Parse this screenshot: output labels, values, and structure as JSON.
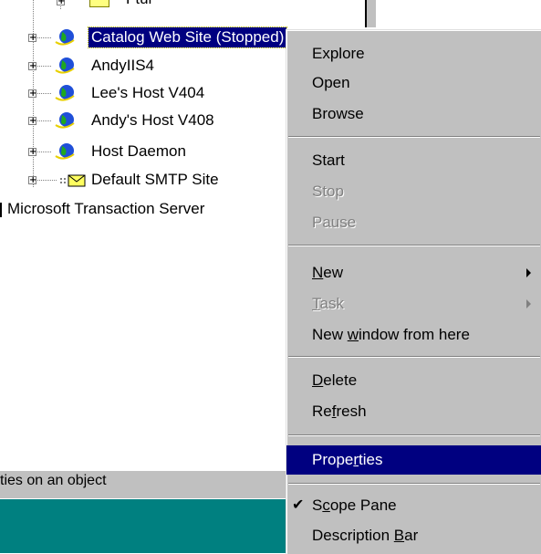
{
  "tree": {
    "partial_top_label": "Ftur",
    "nodes": [
      {
        "label": "Catalog Web Site (Stopped)",
        "icon": "globe-icon",
        "selected": true
      },
      {
        "label": "AndyIIS4",
        "icon": "globe-icon"
      },
      {
        "label": "Lee's Host V404",
        "icon": "globe-icon"
      },
      {
        "label": "Andy's Host V408",
        "icon": "globe-icon"
      },
      {
        "label": "Host Daemon",
        "icon": "globe-icon"
      },
      {
        "label": "Default SMTP Site",
        "icon": "smtp-icon"
      }
    ],
    "root_item": "Microsoft Transaction Server"
  },
  "status_bar": {
    "text": "ties on an object"
  },
  "context_menu": {
    "explore": "Explore",
    "open": "Open",
    "browse": "Browse",
    "start": "Start",
    "stop": "Stop",
    "pause": "Pause",
    "new_pre": "",
    "new_ul": "N",
    "new_post": "ew",
    "task_pre": "",
    "task_ul": "T",
    "task_post": "ask",
    "newwin_pre": "New ",
    "newwin_ul": "w",
    "newwin_post": "indow from here",
    "delete_pre": "",
    "delete_ul": "D",
    "delete_post": "elete",
    "refresh_pre": "Re",
    "refresh_ul": "f",
    "refresh_post": "resh",
    "props_pre": "Prope",
    "props_ul": "r",
    "props_post": "ties",
    "scope_pre": "S",
    "scope_ul": "c",
    "scope_post": "ope Pane",
    "desc_pre": "Description ",
    "desc_ul": "B",
    "desc_post": "ar",
    "check_mark": "✔"
  },
  "colors": {
    "selection": "#000080",
    "menu_bg": "#c0c0c0",
    "taskbar": "#008080"
  }
}
